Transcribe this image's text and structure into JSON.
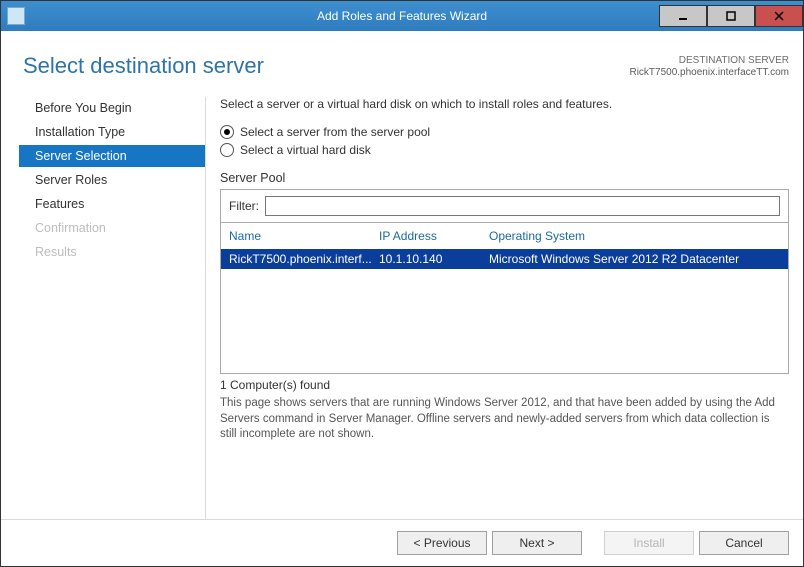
{
  "window": {
    "title": "Add Roles and Features Wizard"
  },
  "header": {
    "page_title": "Select destination server",
    "dest_label": "DESTINATION SERVER",
    "dest_value": "RickT7500.phoenix.interfaceTT.com"
  },
  "sidebar": {
    "items": [
      {
        "label": "Before You Begin",
        "state": "normal"
      },
      {
        "label": "Installation Type",
        "state": "normal"
      },
      {
        "label": "Server Selection",
        "state": "active"
      },
      {
        "label": "Server Roles",
        "state": "normal"
      },
      {
        "label": "Features",
        "state": "normal"
      },
      {
        "label": "Confirmation",
        "state": "disabled"
      },
      {
        "label": "Results",
        "state": "disabled"
      }
    ]
  },
  "main": {
    "instruction": "Select a server or a virtual hard disk on which to install roles and features.",
    "radio1": "Select a server from the server pool",
    "radio2": "Select a virtual hard disk",
    "section_label": "Server Pool",
    "filter_label": "Filter:",
    "filter_value": "",
    "columns": {
      "name": "Name",
      "ip": "IP Address",
      "os": "Operating System"
    },
    "rows": [
      {
        "name": "RickT7500.phoenix.interf...",
        "ip": "10.1.10.140",
        "os": "Microsoft Windows Server 2012 R2 Datacenter"
      }
    ],
    "found": "1 Computer(s) found",
    "description": "This page shows servers that are running Windows Server 2012, and that have been added by using the Add Servers command in Server Manager. Offline servers and newly-added servers from which data collection is still incomplete are not shown."
  },
  "footer": {
    "previous": "< Previous",
    "next": "Next >",
    "install": "Install",
    "cancel": "Cancel"
  }
}
